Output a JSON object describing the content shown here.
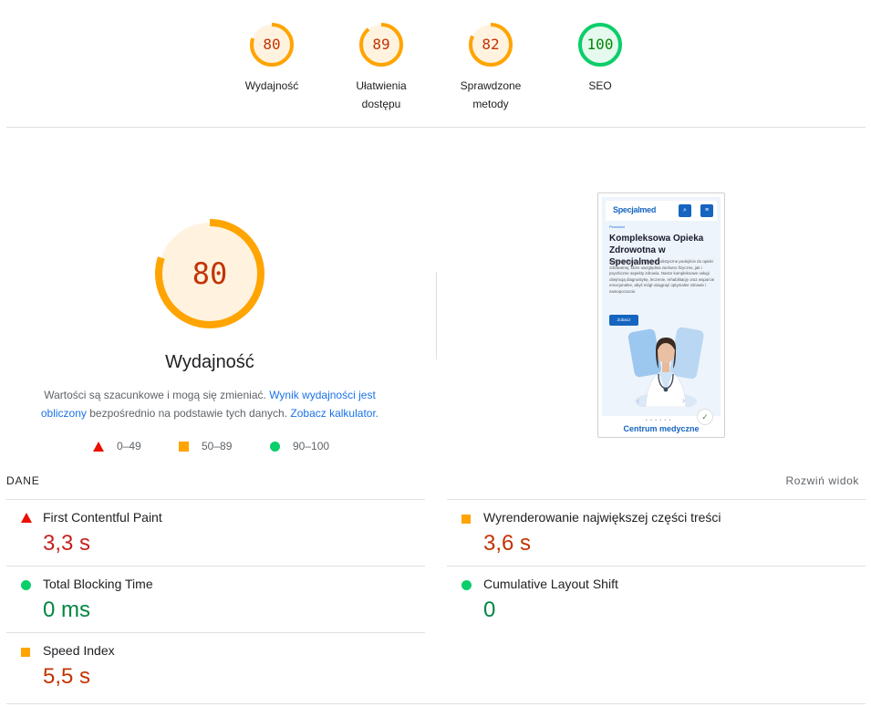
{
  "categories": [
    {
      "score": "80",
      "score_value": 80,
      "label_line1": "Wydajność",
      "label_line2": "",
      "color": "#ffa400",
      "text_color": "#c33300",
      "bg": "#fff3e0"
    },
    {
      "score": "89",
      "score_value": 89,
      "label_line1": "Ułatwienia",
      "label_line2": "dostępu",
      "color": "#ffa400",
      "text_color": "#c33300",
      "bg": "#fff3e0"
    },
    {
      "score": "82",
      "score_value": 82,
      "label_line1": "Sprawdzone",
      "label_line2": "metody",
      "color": "#ffa400",
      "text_color": "#c33300",
      "bg": "#fff3e0"
    },
    {
      "score": "100",
      "score_value": 100,
      "label_line1": "SEO",
      "label_line2": "",
      "color": "#0cce6b",
      "text_color": "#008800",
      "bg": "#e6f9ee"
    }
  ],
  "performance": {
    "score": "80",
    "score_value": 80,
    "title": "Wydajność",
    "desc_prefix": "Wartości są szacunkowe i mogą się zmieniać.",
    "desc_link1": "Wynik wydajności jest obliczony",
    "desc_middle": "bezpośrednio na podstawie tych danych.",
    "desc_link2": "Zobacz kalkulator."
  },
  "legend": [
    {
      "icon": "triangle-icon",
      "range": "0–49"
    },
    {
      "icon": "square-icon",
      "range": "50–89"
    },
    {
      "icon": "circle-icon",
      "range": "90–100"
    }
  ],
  "screenshot": {
    "logo": "Specjalmed",
    "search_icon": "⌕",
    "menu_icon": "≡",
    "tag": "Pewności",
    "headline": "Kompleksowa Opieka Zdrowotna w Specjalmed",
    "body": "W Specjalmed wierzymy w holistyczne podejście do opieki zdrowotnej, które uwzględnia zarówno fizyczne, jak i psychiczne aspekty zdrowia. Nasze kompleksowe usługi obejmują diagnostykę, leczenie, rehabilitację oraz wsparcie emocjonalne, abyś mógł osiągnąć optymalne zdrowie i samopoczucie.",
    "cta": "Zobacz",
    "prev": "‹",
    "next": "›",
    "dots": "• • • • • •",
    "badge": "✓",
    "footer": "Centrum medyczne"
  },
  "metrics_header": {
    "title": "DANE",
    "expand": "Rozwiń widok"
  },
  "metrics": [
    {
      "icon": "triangle-icon",
      "label": "First Contentful Paint",
      "value": "3,3 s",
      "status": "red"
    },
    {
      "icon": "square-icon",
      "label": "Wyrenderowanie największej części treści",
      "value": "3,6 s",
      "status": "orange"
    },
    {
      "icon": "circle-icon",
      "label": "Total Blocking Time",
      "value": "0 ms",
      "status": "green"
    },
    {
      "icon": "circle-icon",
      "label": "Cumulative Layout Shift",
      "value": "0",
      "status": "green"
    },
    {
      "icon": "square-icon",
      "label": "Speed Index",
      "value": "5,5 s",
      "status": "orange"
    }
  ]
}
